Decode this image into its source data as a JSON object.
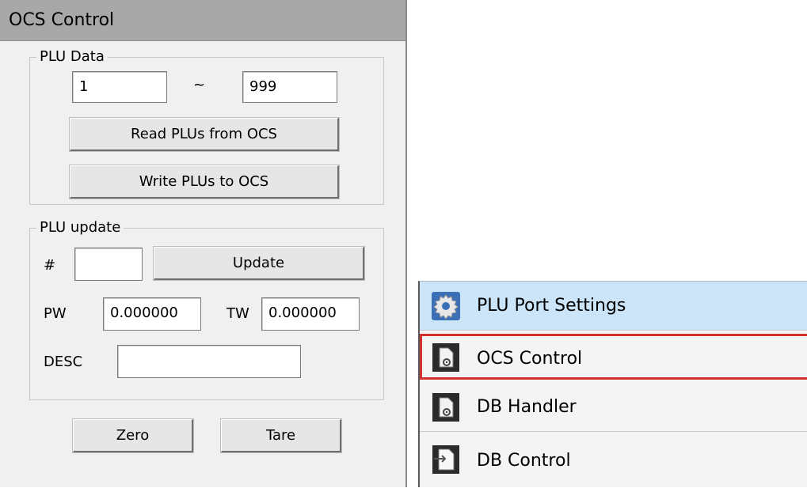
{
  "panel": {
    "title": "OCS Control",
    "plu_data": {
      "legend": "PLU Data",
      "from_value": "1",
      "separator": "~",
      "to_value": "999",
      "read_button": "Read PLUs from OCS",
      "write_button": "Write PLUs to OCS"
    },
    "plu_update": {
      "legend": "PLU update",
      "number_label": "#",
      "number_value": "",
      "update_button": "Update",
      "pw_label": "PW",
      "pw_value": "0.000000",
      "tw_label": "TW",
      "tw_value": "0.000000",
      "desc_label": "DESC",
      "desc_value": ""
    },
    "zero_button": "Zero",
    "tare_button": "Tare"
  },
  "nav": {
    "items": [
      {
        "label": "PLU Port Settings",
        "icon": "gear-icon",
        "selected": true
      },
      {
        "label": "OCS Control",
        "icon": "document-gear-icon",
        "highlighted": true
      },
      {
        "label": "DB Handler",
        "icon": "document-gear-icon"
      },
      {
        "label": "DB Control",
        "icon": "document-arrow-icon"
      }
    ],
    "colors": {
      "selected_bg": "#cce4f7",
      "highlight_border": "#d0312d"
    }
  }
}
